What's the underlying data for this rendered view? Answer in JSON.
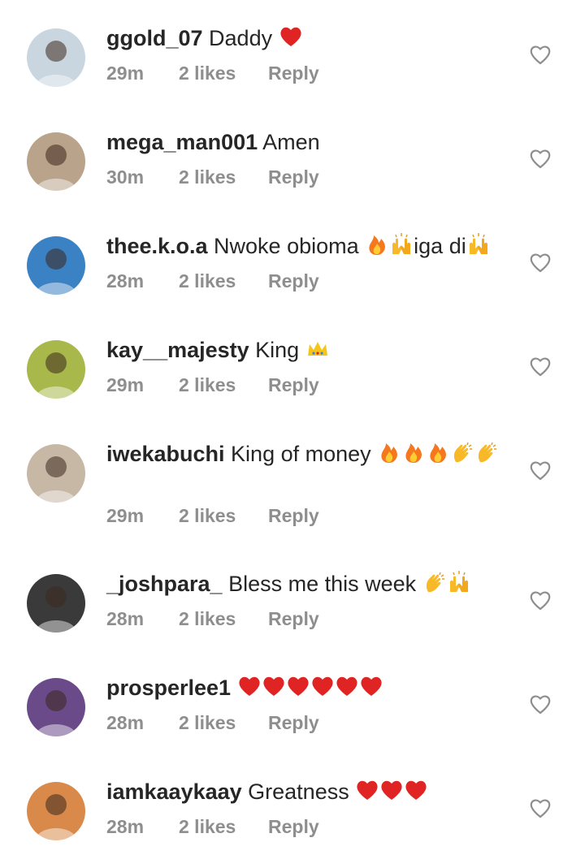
{
  "comments": [
    {
      "username": "ggold_07",
      "text": "Daddy",
      "emoji": [
        "red-heart"
      ],
      "time": "29m",
      "likes": "2 likes",
      "reply": "Reply",
      "avatar_color": "#c9d6df"
    },
    {
      "username": "mega_man001",
      "text": "Amen",
      "emoji": [],
      "time": "30m",
      "likes": "2 likes",
      "reply": "Reply",
      "avatar_color": "#b9a38a"
    },
    {
      "username": "thee.k.o.a",
      "text": "Nwoke obioma",
      "emoji": [
        "fire",
        "raising-hands"
      ],
      "text2": "iga di",
      "emoji2": [
        "raising-hands"
      ],
      "time": "28m",
      "likes": "2 likes",
      "reply": "Reply",
      "avatar_color": "#3b82c4"
    },
    {
      "username": "kay__majesty",
      "text": "King",
      "emoji": [
        "crown"
      ],
      "time": "29m",
      "likes": "2 likes",
      "reply": "Reply",
      "avatar_color": "#a8b84a"
    },
    {
      "username": "iwekabuchi",
      "text": "King of money",
      "emoji": [
        "fire",
        "fire",
        "fire",
        "clapping-hands",
        "clapping-hands"
      ],
      "time": "29m",
      "likes": "2 likes",
      "reply": "Reply",
      "avatar_color": "#c7b8a6"
    },
    {
      "username": "_joshpara_",
      "text": "Bless me this week",
      "emoji": [
        "clapping-hands",
        "raising-hands"
      ],
      "time": "28m",
      "likes": "2 likes",
      "reply": "Reply",
      "avatar_color": "#3a3a3a"
    },
    {
      "username": "prosperlee1",
      "text": "",
      "emoji": [
        "red-heart",
        "red-heart",
        "red-heart",
        "red-heart",
        "red-heart",
        "red-heart"
      ],
      "time": "28m",
      "likes": "2 likes",
      "reply": "Reply",
      "avatar_color": "#6b4a8a"
    },
    {
      "username": "iamkaaykaay",
      "text": "Greatness",
      "emoji": [
        "red-heart",
        "red-heart",
        "red-heart"
      ],
      "time": "28m",
      "likes": "2 likes",
      "reply": "Reply",
      "avatar_color": "#d98a4a"
    }
  ],
  "colors": {
    "text": "#262626",
    "meta": "#8e8e8e",
    "heart": "#e02424",
    "like_outline": "#8e8e8e"
  },
  "icons": {
    "like": "heart-outline-icon"
  }
}
